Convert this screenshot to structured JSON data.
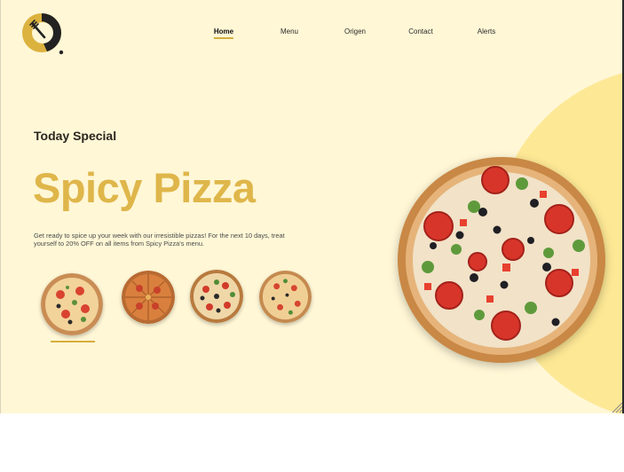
{
  "nav": {
    "items": [
      {
        "label": "Home",
        "active": true
      },
      {
        "label": "Menu",
        "active": false
      },
      {
        "label": "Origen",
        "active": false
      },
      {
        "label": "Contact",
        "active": false
      },
      {
        "label": "Alerts",
        "active": false
      }
    ]
  },
  "hero": {
    "eyebrow": "Today Special",
    "title": "Spicy Pizza",
    "description": "Get ready to spice up your week with our irresistible pizzas! For the next 10 days, treat yourself to 20% OFF on all items from Spicy Pizza's menu.",
    "selected_thumbnail": 0
  },
  "thumbnails": [
    {
      "icon": "pizza-thumbnail-1-icon"
    },
    {
      "icon": "pizza-thumbnail-2-icon"
    },
    {
      "icon": "pizza-thumbnail-3-icon"
    },
    {
      "icon": "pizza-thumbnail-4-icon"
    }
  ],
  "colors": {
    "background": "#fff7d6",
    "accent": "#dfb64a",
    "blob": "#fde895",
    "text_dark": "#2a2620"
  },
  "icons": {
    "logo": "clock-fork-logo-icon",
    "hero_image": "spicy-pizza-image"
  }
}
